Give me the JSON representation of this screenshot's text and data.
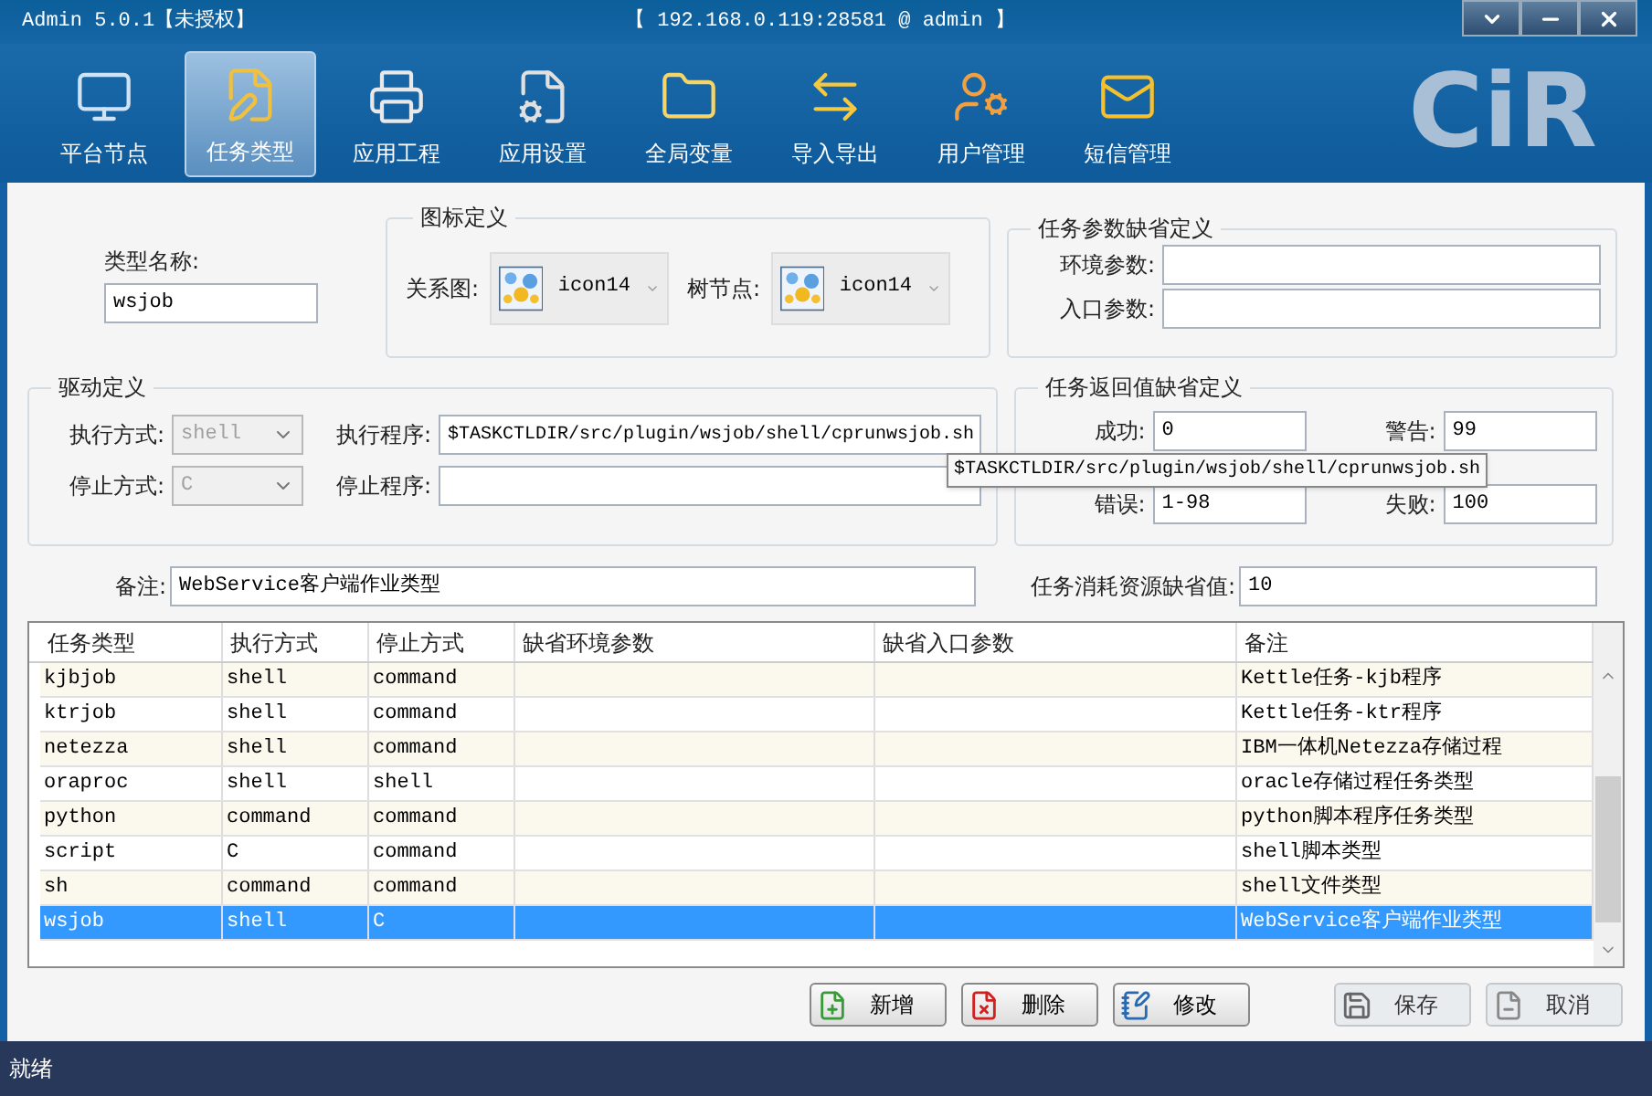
{
  "window": {
    "title": "Admin 5.0.1【未授权】",
    "connection": "【 192.168.0.119:28581 @ admin 】"
  },
  "logo": "CiR",
  "toolbar": [
    {
      "label": "平台节点",
      "selected": false
    },
    {
      "label": "任务类型",
      "selected": true
    },
    {
      "label": "应用工程",
      "selected": false
    },
    {
      "label": "应用设置",
      "selected": false
    },
    {
      "label": "全局变量",
      "selected": false
    },
    {
      "label": "导入导出",
      "selected": false
    },
    {
      "label": "用户管理",
      "selected": false
    },
    {
      "label": "短信管理",
      "selected": false
    }
  ],
  "form": {
    "type_name": {
      "label": "类型名称:",
      "value": "wsjob"
    },
    "icon_group": {
      "title": "图标定义",
      "relation": {
        "label": "关系图:",
        "value": "icon14"
      },
      "tree": {
        "label": "树节点:",
        "value": "icon14"
      }
    },
    "param_group": {
      "title": "任务参数缺省定义",
      "fields": [
        {
          "label": "环境参数:"
        },
        {
          "label": "入口参数:"
        }
      ]
    },
    "driver_group": {
      "title": "驱动定义",
      "exec_mode": {
        "label": "执行方式:",
        "value": "shell",
        "disabled": true
      },
      "exec_program": {
        "label": "执行程序:",
        "value": "$TASKCTLDIR/src/plugin/wsjob/shell/cprunwsjob.sh"
      },
      "stop_mode": {
        "label": "停止方式:",
        "value": "C",
        "disabled": true
      },
      "stop_program": {
        "label": "停止程序:"
      }
    },
    "return_group": {
      "title": "任务返回值缺省定义",
      "fields": [
        {
          "label": "成功:",
          "value": "0"
        },
        {
          "label": "警告:",
          "value": "99"
        },
        {
          "label": "错误:",
          "value": "1-98"
        },
        {
          "label": "失败:",
          "value": "100"
        }
      ]
    },
    "remark": {
      "label": "备注:",
      "value": "WebService客户端作业类型"
    },
    "resource": {
      "label": "任务消耗资源缺省值:",
      "value": "10"
    }
  },
  "tooltip": "$TASKCTLDIR/src/plugin/wsjob/shell/cprunwsjob.sh",
  "table": {
    "columns": [
      "任务类型",
      "执行方式",
      "停止方式",
      "缺省环境参数",
      "缺省入口参数",
      "备注"
    ],
    "rows": [
      {
        "cells": [
          "kjbjob",
          "shell",
          "command",
          "",
          "",
          "Kettle任务-kjb程序"
        ],
        "selected": false
      },
      {
        "cells": [
          "ktrjob",
          "shell",
          "command",
          "",
          "",
          "Kettle任务-ktr程序"
        ],
        "selected": false
      },
      {
        "cells": [
          "netezza",
          "shell",
          "command",
          "",
          "",
          "IBM一体机Netezza存储过程"
        ],
        "selected": false
      },
      {
        "cells": [
          "oraproc",
          "shell",
          "shell",
          "",
          "",
          "oracle存储过程任务类型"
        ],
        "selected": false
      },
      {
        "cells": [
          "python",
          "command",
          "command",
          "",
          "",
          "python脚本程序任务类型"
        ],
        "selected": false
      },
      {
        "cells": [
          "script",
          "C",
          "command",
          "",
          "",
          "shell脚本类型"
        ],
        "selected": false
      },
      {
        "cells": [
          "sh",
          "command",
          "command",
          "",
          "",
          "shell文件类型"
        ],
        "selected": false
      },
      {
        "cells": [
          "wsjob",
          "shell",
          "C",
          "",
          "",
          "WebService客户端作业类型"
        ],
        "selected": true
      }
    ]
  },
  "buttons": [
    {
      "label": "新增",
      "disabled": false
    },
    {
      "label": "删除",
      "disabled": false
    },
    {
      "label": "修改",
      "disabled": false
    },
    {
      "label": "保存",
      "disabled": true
    },
    {
      "label": "取消",
      "disabled": true
    }
  ],
  "status_bar": "就绪"
}
